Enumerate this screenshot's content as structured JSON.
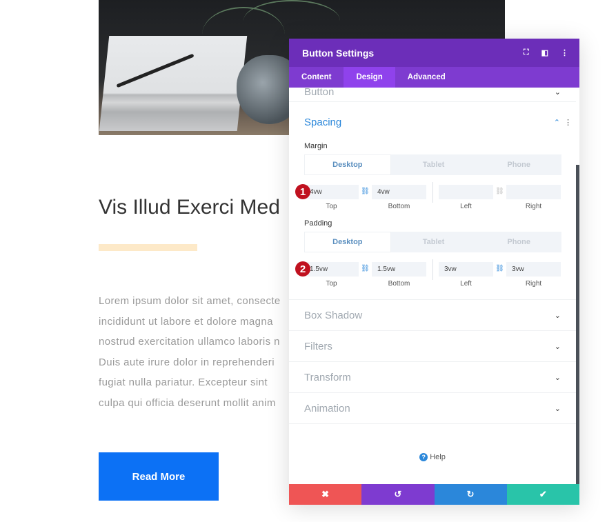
{
  "page": {
    "title": "Vis Illud Exerci Med",
    "lorem_lines": [
      "Lorem ipsum dolor sit amet, consecte",
      "incididunt ut labore et dolore magna",
      "nostrud exercitation ullamco laboris n",
      "Duis aute irure dolor in reprehenderi",
      "fugiat nulla pariatur. Excepteur sint",
      "culpa qui officia deserunt mollit anim"
    ],
    "button_label": "Read More",
    "accent_bar_color": "#fde9c8",
    "button_color": "#0c71f5"
  },
  "panel": {
    "title": "Button Settings",
    "header_icons": [
      "fullscreen-icon",
      "split-view-icon",
      "more-options-icon"
    ],
    "tabs": [
      {
        "label": "Content"
      },
      {
        "label": "Design",
        "active": true
      },
      {
        "label": "Advanced"
      }
    ],
    "sections_before": [
      {
        "label": "Button"
      }
    ],
    "spacing": {
      "label": "Spacing",
      "margin": {
        "label": "Margin",
        "devices": [
          "Desktop",
          "Tablet",
          "Phone"
        ],
        "top": "4vw",
        "bottom": "4vw",
        "left": "",
        "right": "",
        "captions": [
          "Top",
          "Bottom",
          "Left",
          "Right"
        ],
        "badge": "1"
      },
      "padding": {
        "label": "Padding",
        "devices": [
          "Desktop",
          "Tablet",
          "Phone"
        ],
        "top": "1.5vw",
        "bottom": "1.5vw",
        "left": "3vw",
        "right": "3vw",
        "captions": [
          "Top",
          "Bottom",
          "Left",
          "Right"
        ],
        "badge": "2"
      }
    },
    "sections_after": [
      {
        "label": "Box Shadow"
      },
      {
        "label": "Filters"
      },
      {
        "label": "Transform"
      },
      {
        "label": "Animation"
      }
    ],
    "help": "Help",
    "footer": [
      {
        "name": "cancel",
        "icon": "✖",
        "color": "#ef5555"
      },
      {
        "name": "undo",
        "icon": "↺",
        "color": "#7e3bd0"
      },
      {
        "name": "redo",
        "icon": "↻",
        "color": "#2b87da"
      },
      {
        "name": "save",
        "icon": "✔",
        "color": "#29c4a9"
      }
    ],
    "colors": {
      "header": "#6c2eb9",
      "tabs": "#7e3bd0",
      "active_tab": "#8f42ec"
    }
  }
}
